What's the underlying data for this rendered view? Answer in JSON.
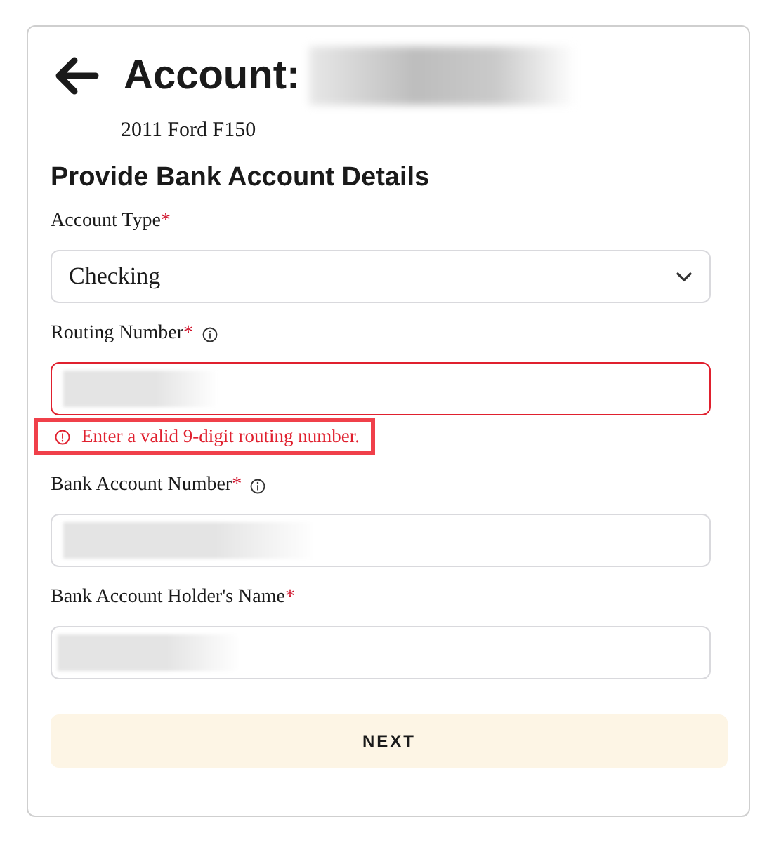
{
  "header": {
    "title": "Account:",
    "title_value_redacted": true,
    "subtitle": "2011 Ford F150"
  },
  "section_title": "Provide Bank Account Details",
  "fields": [
    {
      "kind": "select",
      "label": "Account Type",
      "required_mark": "*",
      "info": false,
      "value": "Checking",
      "value_redacted": false,
      "error": false
    },
    {
      "kind": "text",
      "label": "Routing Number",
      "required_mark": "*",
      "info": true,
      "value_redacted": true,
      "error": true,
      "error_message": "Enter a valid 9-digit routing number.",
      "error_highlighted": true
    },
    {
      "kind": "text",
      "label": "Bank Account Number",
      "required_mark": "*",
      "info": true,
      "value_redacted": true,
      "error": false
    },
    {
      "kind": "text",
      "label": "Bank Account Holder's Name",
      "required_mark": "*",
      "info": false,
      "value_redacted": true,
      "error": false
    }
  ],
  "next_button": {
    "label": "NEXT"
  }
}
